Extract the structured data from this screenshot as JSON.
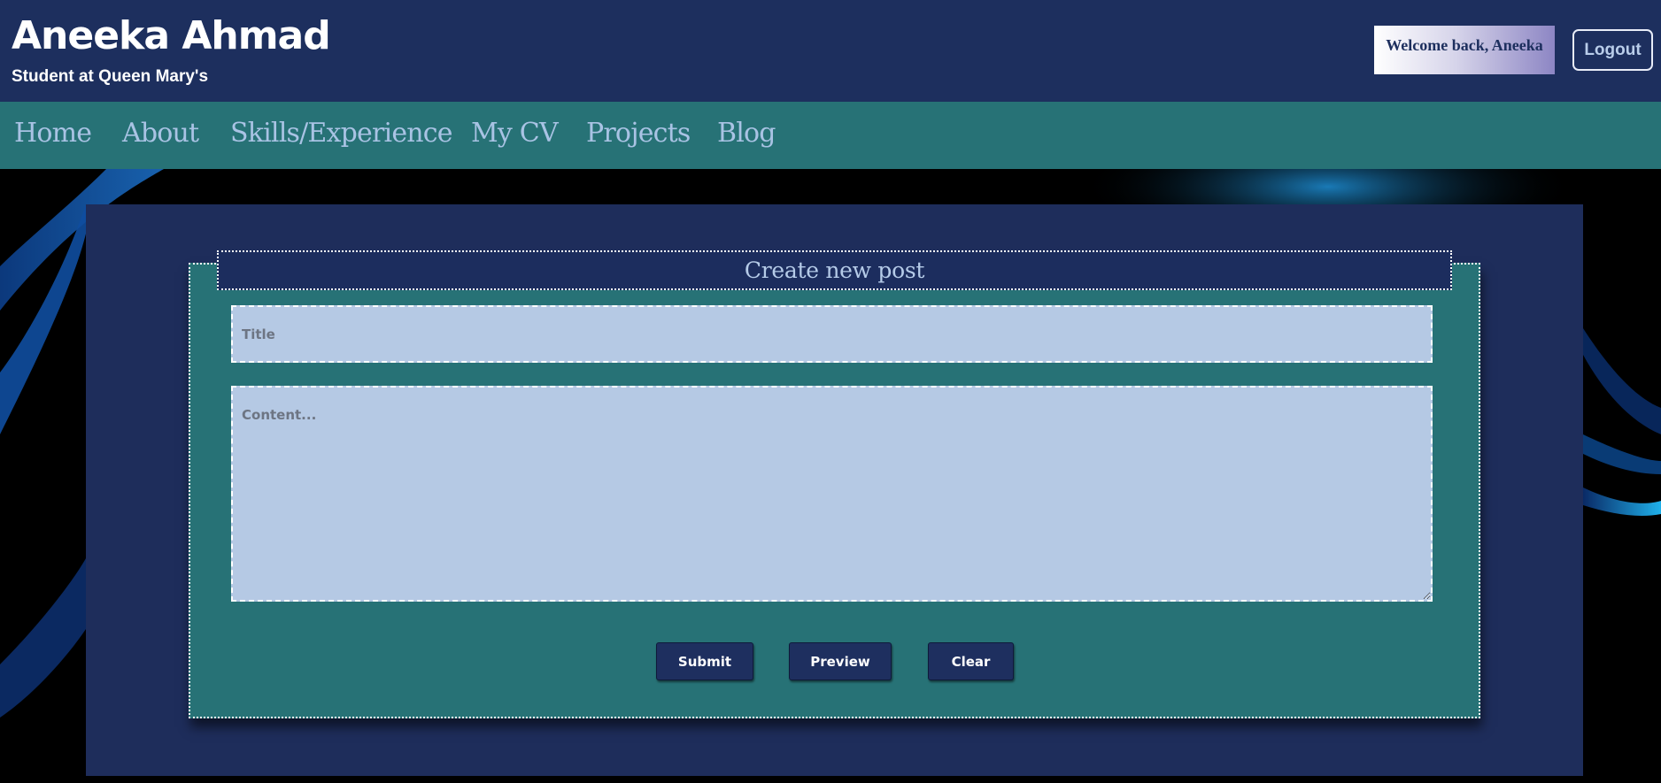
{
  "header": {
    "name": "Aneeka Ahmad",
    "subtitle": "Student at Queen Mary's",
    "welcome": "Welcome back, Aneeka",
    "logout_label": "Logout"
  },
  "nav": {
    "items": [
      {
        "label": "Home"
      },
      {
        "label": "About"
      },
      {
        "label": "Skills/Experience"
      },
      {
        "label": "My CV"
      },
      {
        "label": "Projects"
      },
      {
        "label": "Blog"
      }
    ]
  },
  "form": {
    "heading": "Create new post",
    "title_placeholder": "Title",
    "title_value": "",
    "content_placeholder": "Content...",
    "content_value": "",
    "buttons": {
      "submit": "Submit",
      "preview": "Preview",
      "clear": "Clear"
    }
  },
  "colors": {
    "header_bg": "#1d2f5e",
    "nav_bg": "#277276",
    "panel_bg": "#1e2d5b",
    "form_bg": "#277276",
    "input_bg": "#b5c9e4",
    "nav_text": "#a9c3e4"
  }
}
